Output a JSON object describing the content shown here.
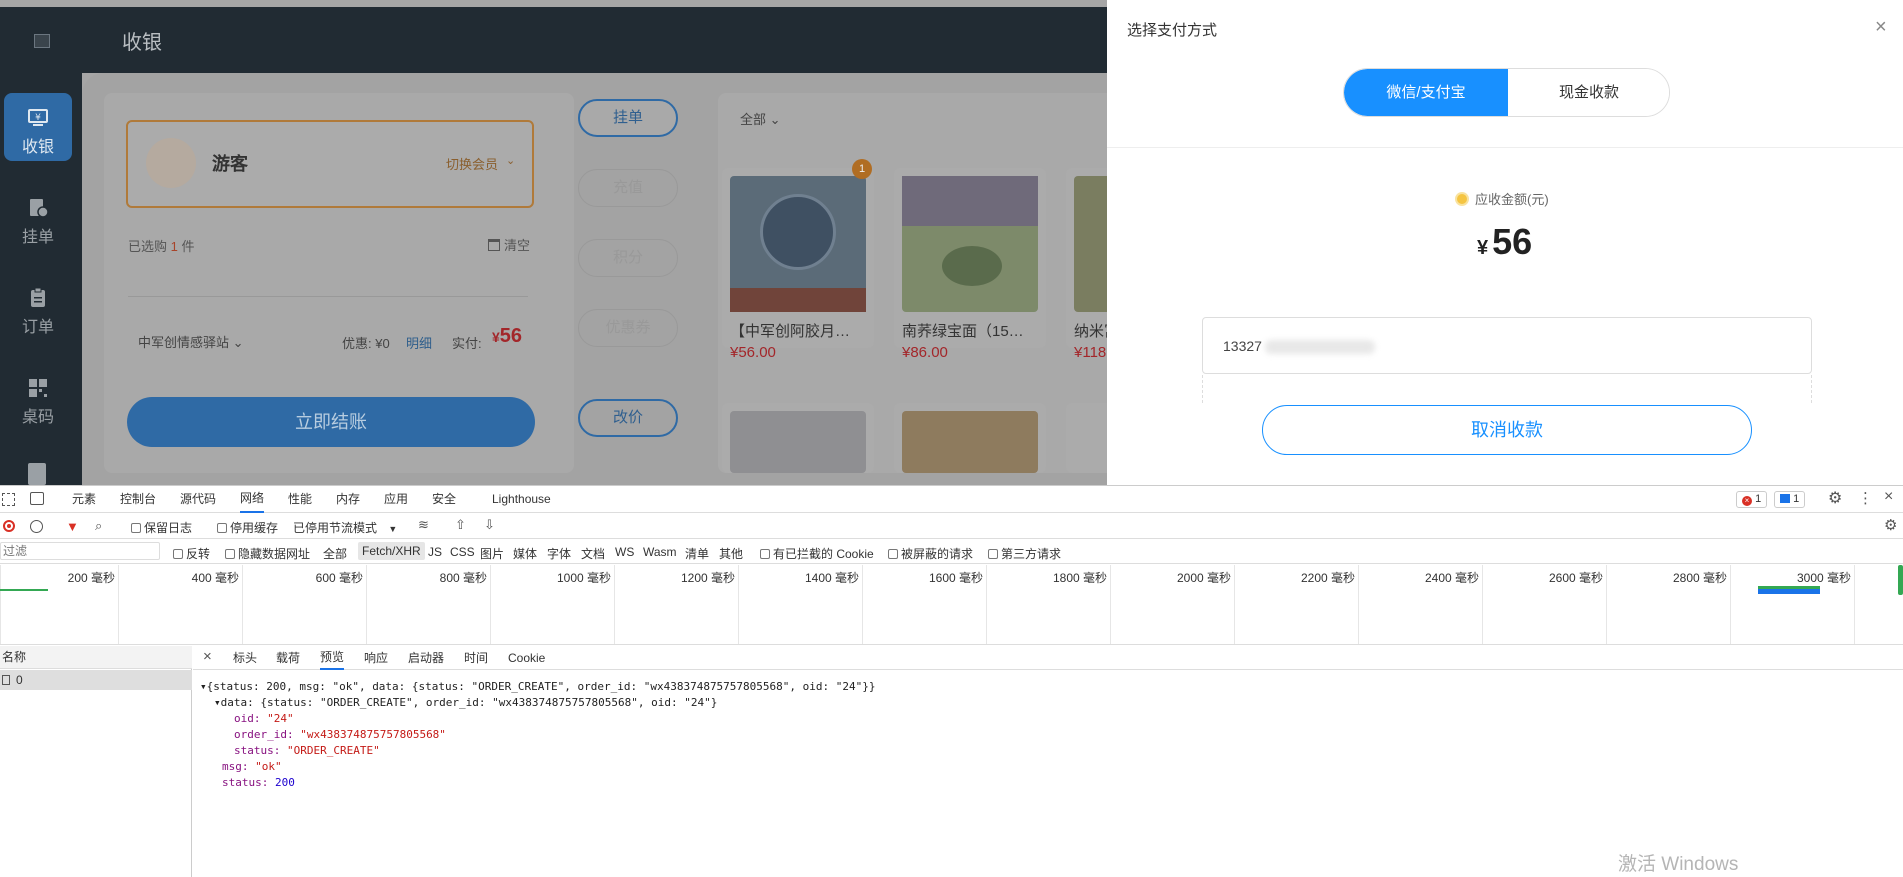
{
  "app": {
    "title": "收银",
    "nav": [
      {
        "label": "收银",
        "icon": "cashier-icon"
      },
      {
        "label": "挂单",
        "icon": "pending-order-icon"
      },
      {
        "label": "订单",
        "icon": "orders-icon"
      },
      {
        "label": "桌码",
        "icon": "qrcode-icon"
      }
    ],
    "customer": {
      "name": "游客",
      "switch_label": "切换会员"
    },
    "cart": {
      "selected_prefix": "已选购",
      "selected_count": "1",
      "selected_suffix": "件",
      "clear_label": "清空"
    },
    "store": {
      "name": "中军创情感驿站"
    },
    "totals": {
      "discount_label": "优惠: ¥0",
      "detail_label": "明细",
      "actual_label": "实付:",
      "currency": "¥",
      "actual_value": "56"
    },
    "checkout_label": "立即结账",
    "side_buttons": [
      "挂单",
      "充值",
      "积分",
      "优惠券",
      "改价"
    ],
    "category_filter": "全部",
    "products": [
      {
        "name": "【中军创阿胶月…",
        "price": "¥56.00",
        "badge": "1"
      },
      {
        "name": "南荞绿宝面（15…",
        "price": "¥86.00"
      },
      {
        "name": "纳米富",
        "price": "¥118"
      }
    ]
  },
  "drawer": {
    "title": "选择支付方式",
    "tabs": [
      "微信/支付宝",
      "现金收款"
    ],
    "amount_label": "应收金额(元)",
    "currency": "¥",
    "amount": "56",
    "code_input": "13327",
    "cancel_label": "取消收款"
  },
  "devtools": {
    "tabs": [
      "元素",
      "控制台",
      "源代码",
      "网络",
      "性能",
      "内存",
      "应用",
      "安全",
      "Lighthouse"
    ],
    "errors": "1",
    "messages": "1",
    "toolbar": {
      "preserve_log": "保留日志",
      "disable_cache": "停用缓存",
      "throttle": "已停用节流模式"
    },
    "filter": {
      "placeholder": "过滤",
      "invert": "反转",
      "hide_data_urls": "隐藏数据网址",
      "types": [
        "全部",
        "Fetch/XHR",
        "JS",
        "CSS",
        "图片",
        "媒体",
        "字体",
        "文档",
        "WS",
        "Wasm",
        "清单",
        "其他"
      ],
      "blocked_cookies": "有已拦截的 Cookie",
      "blocked_requests": "被屏蔽的请求",
      "third_party": "第三方请求"
    },
    "timeline_ticks": [
      "200 毫秒",
      "400 毫秒",
      "600 毫秒",
      "800 毫秒",
      "1000 毫秒",
      "1200 毫秒",
      "1400 毫秒",
      "1600 毫秒",
      "1800 毫秒",
      "2000 毫秒",
      "2200 毫秒",
      "2400 毫秒",
      "2600 毫秒",
      "2800 毫秒",
      "3000 毫秒"
    ],
    "name_header": "名称",
    "request_name": "0",
    "detail_tabs": [
      "标头",
      "载荷",
      "预览",
      "响应",
      "启动器",
      "时间",
      "Cookie"
    ],
    "preview": {
      "root": "{status: 200, msg: \"ok\", data: {status: \"ORDER_CREATE\", order_id: \"wx438374875757805568\", oid: \"24\"}}",
      "data_line": "data: {status: \"ORDER_CREATE\", order_id: \"wx438374875757805568\", oid: \"24\"}",
      "oid_key": "oid:",
      "oid_val": "\"24\"",
      "order_key": "order_id:",
      "order_val": "\"wx438374875757805568\"",
      "status_key": "status:",
      "status_val": "\"ORDER_CREATE\"",
      "msg_key": "msg:",
      "msg_val": "\"ok\"",
      "code_key": "status:",
      "code_val": "200"
    }
  },
  "watermark": "激活 Windows",
  "colors": {
    "accent": "#1890ff",
    "price": "#e4393c",
    "sidebar": "#212b33"
  }
}
